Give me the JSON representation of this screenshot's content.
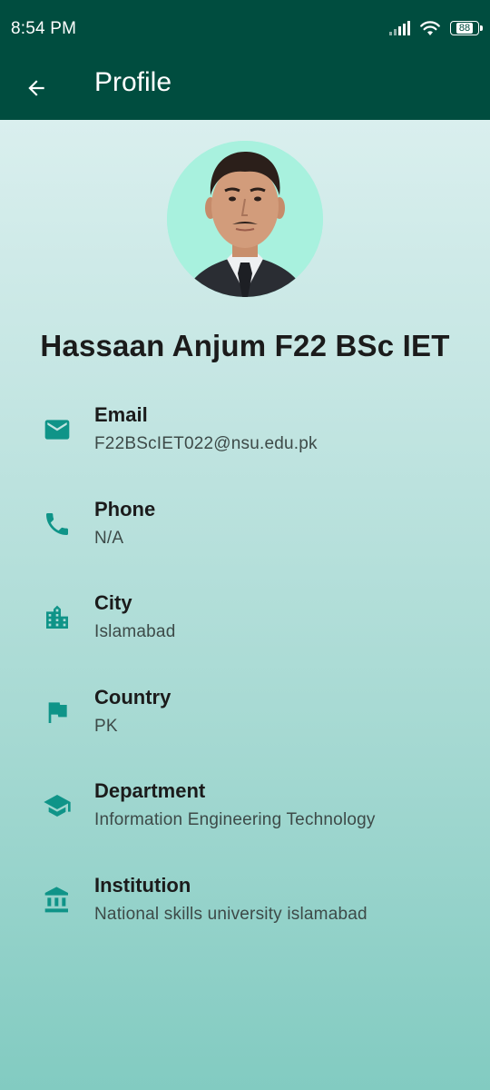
{
  "status_bar": {
    "time": "8:54 PM",
    "battery_level": "88",
    "icons": [
      "signal-icon",
      "wifi-icon",
      "battery-icon"
    ]
  },
  "app_bar": {
    "back_icon": "arrow-back-icon",
    "title": "Profile"
  },
  "profile": {
    "avatar": "profile-photo",
    "name": "Hassaan Anjum F22 BSc IET"
  },
  "info": [
    {
      "icon": "email-icon",
      "label": "Email",
      "value": "F22BScIET022@nsu.edu.pk"
    },
    {
      "icon": "phone-icon",
      "label": "Phone",
      "value": "N/A"
    },
    {
      "icon": "city-icon",
      "label": "City",
      "value": "Islamabad"
    },
    {
      "icon": "flag-icon",
      "label": "Country",
      "value": "PK"
    },
    {
      "icon": "graduation-cap-icon",
      "label": "Department",
      "value": "Information Engineering Technology"
    },
    {
      "icon": "institution-icon",
      "label": "Institution",
      "value": "National skills university islamabad"
    }
  ],
  "colors": {
    "app_bar": "#004d3f",
    "icon": "#0f9488",
    "text": "#1b1b1b",
    "secondary_text": "#3d4a48",
    "avatar_bg": "#a8f1de"
  }
}
